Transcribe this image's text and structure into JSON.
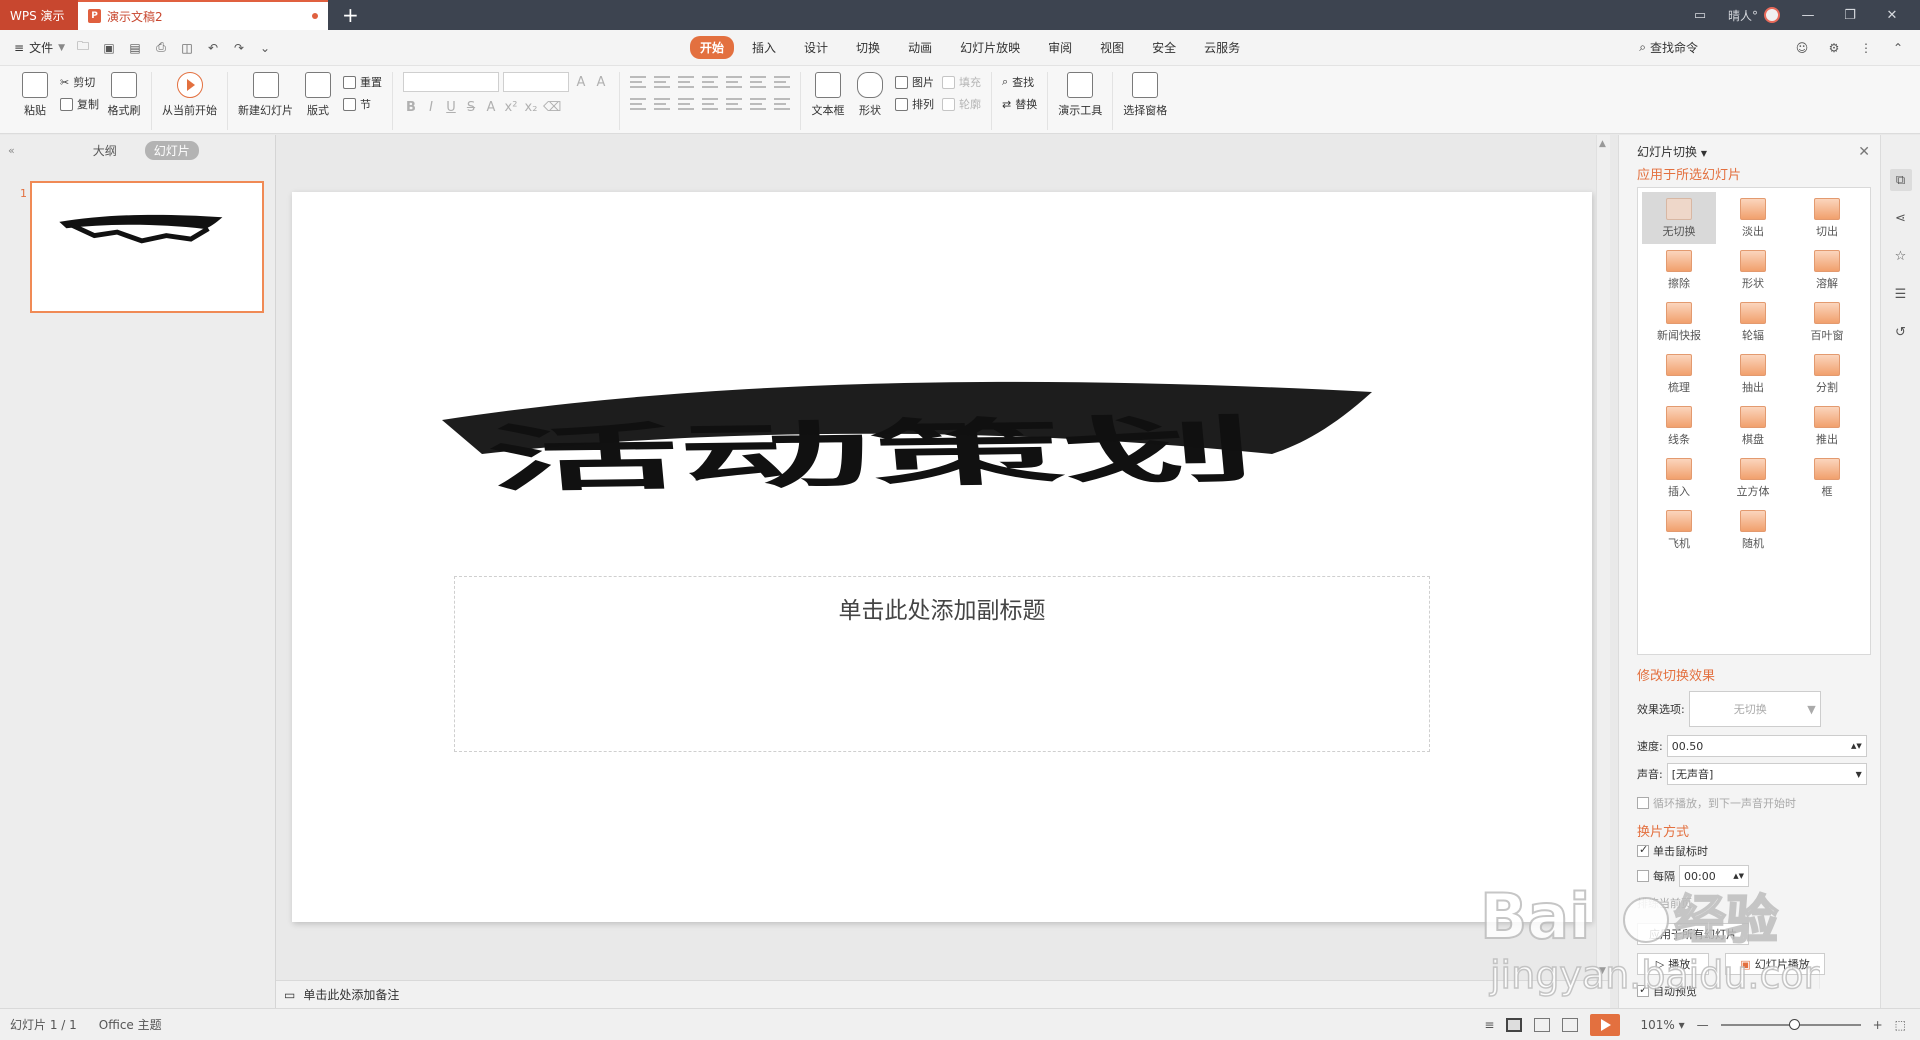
{
  "titlebar": {
    "app_tab": "WPS 演示",
    "doc_tab": "演示文稿2",
    "user_name": "晴人°"
  },
  "menubar": {
    "file_label": "文件",
    "tabs": [
      "开始",
      "插入",
      "设计",
      "切换",
      "动画",
      "幻灯片放映",
      "审阅",
      "视图",
      "安全",
      "云服务"
    ],
    "active_tab": "开始",
    "search_label": "查找命令"
  },
  "ribbon": {
    "paste": "粘贴",
    "cut": "剪切",
    "copy": "复制",
    "format_painter": "格式刷",
    "play_from_current": "从当前开始",
    "new_slide": "新建幻灯片",
    "layout": "版式",
    "reset": "重置",
    "section": "节",
    "text_box": "文本框",
    "shape": "形状",
    "picture": "图片",
    "fill": "填充",
    "arrange": "排列",
    "outline": "轮廓",
    "find": "查找",
    "replace": "替换",
    "presentation_tools": "演示工具",
    "selection_pane": "选择窗格"
  },
  "left_panel": {
    "tab_outline": "大纲",
    "tab_slides": "幻灯片",
    "slide_number": "1"
  },
  "slide": {
    "title_art": "活动策划",
    "subtitle_placeholder": "单击此处添加副标题"
  },
  "notes": {
    "placeholder": "单击此处添加备注"
  },
  "task_pane": {
    "title": "幻灯片切换",
    "apply_to_selected": "应用于所选幻灯片",
    "transitions": [
      "无切换",
      "淡出",
      "切出",
      "擦除",
      "形状",
      "溶解",
      "新闻快报",
      "轮辐",
      "百叶窗",
      "梳理",
      "抽出",
      "分割",
      "线条",
      "棋盘",
      "推出",
      "插入",
      "立方体",
      "框",
      "飞机",
      "随机"
    ],
    "selected_transition": "无切换",
    "modify_section": "修改切换效果",
    "effect_options_label": "效果选项:",
    "effect_options_value": "无切换",
    "speed_label": "速度:",
    "speed_value": "00.50",
    "sound_label": "声音:",
    "sound_value": "[无声音]",
    "loop_label": "循环播放，到下一声音开始时",
    "advance_section": "换片方式",
    "on_click_label": "单击鼠标时",
    "every_label": "每隔",
    "every_value": "00:00",
    "row_obscured": "排练当前页",
    "apply_all_label": "应用于所有幻灯片",
    "play_label": "播放",
    "slideshow_label": "幻灯片播放",
    "auto_preview_label": "自动预览"
  },
  "statusbar": {
    "slide_count": "幻灯片 1 / 1",
    "theme": "Office 主题",
    "zoom": "101%"
  },
  "watermark": {
    "brand": "Bai",
    "brand_cn": "经验",
    "url": "jingyan.baidu.com"
  },
  "colors": {
    "accent": "#e3703f",
    "titlebar": "#3d4450",
    "app_tab": "#c8472f"
  }
}
